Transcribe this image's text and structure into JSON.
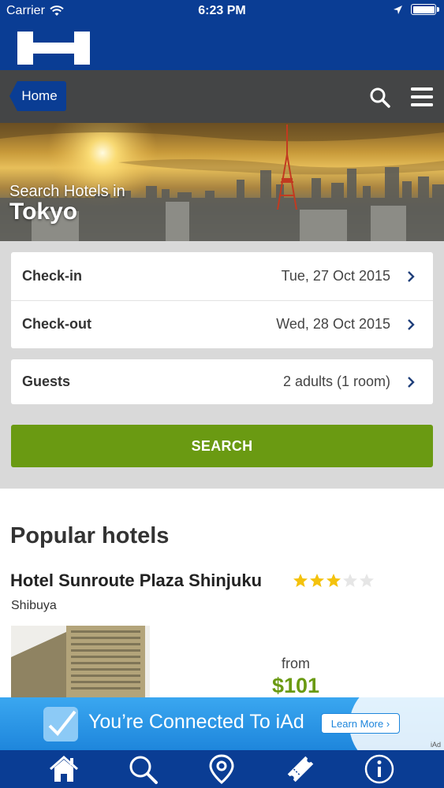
{
  "status_bar": {
    "carrier": "Carrier",
    "time": "6:23 PM",
    "wifi_icon": "wifi-icon",
    "location_icon": "location-arrow-icon",
    "battery_icon": "battery-icon"
  },
  "brand": {
    "logo_icon": "hotels-h-logo"
  },
  "nav": {
    "home_label": "Home",
    "search_icon": "search-icon",
    "menu_icon": "hamburger-menu-icon"
  },
  "hero": {
    "subtitle": "Search Hotels in",
    "city": "Tokyo"
  },
  "form": {
    "checkin_label": "Check-in",
    "checkin_value": "Tue, 27 Oct 2015",
    "checkout_label": "Check-out",
    "checkout_value": "Wed, 28 Oct 2015",
    "guests_label": "Guests",
    "guests_value": "2 adults (1 room)",
    "search_label": "SEARCH"
  },
  "popular": {
    "title": "Popular hotels",
    "hotels": [
      {
        "name": "Hotel Sunroute Plaza Shinjuku",
        "stars": 3,
        "max_stars": 5,
        "area": "Shibuya",
        "from_label": "from",
        "price": "$101"
      }
    ]
  },
  "ad": {
    "text": "You’re Connected To iAd",
    "button": "Learn More",
    "tag": "iAd"
  },
  "tabbar": {
    "items": [
      "home-icon",
      "search-icon",
      "map-pin-icon",
      "ticket-icon",
      "info-icon"
    ]
  },
  "colors": {
    "brand_blue": "#0a3d94",
    "nav_gray": "#444546",
    "search_green": "#6a9a12",
    "star_gold": "#f4c20d"
  }
}
